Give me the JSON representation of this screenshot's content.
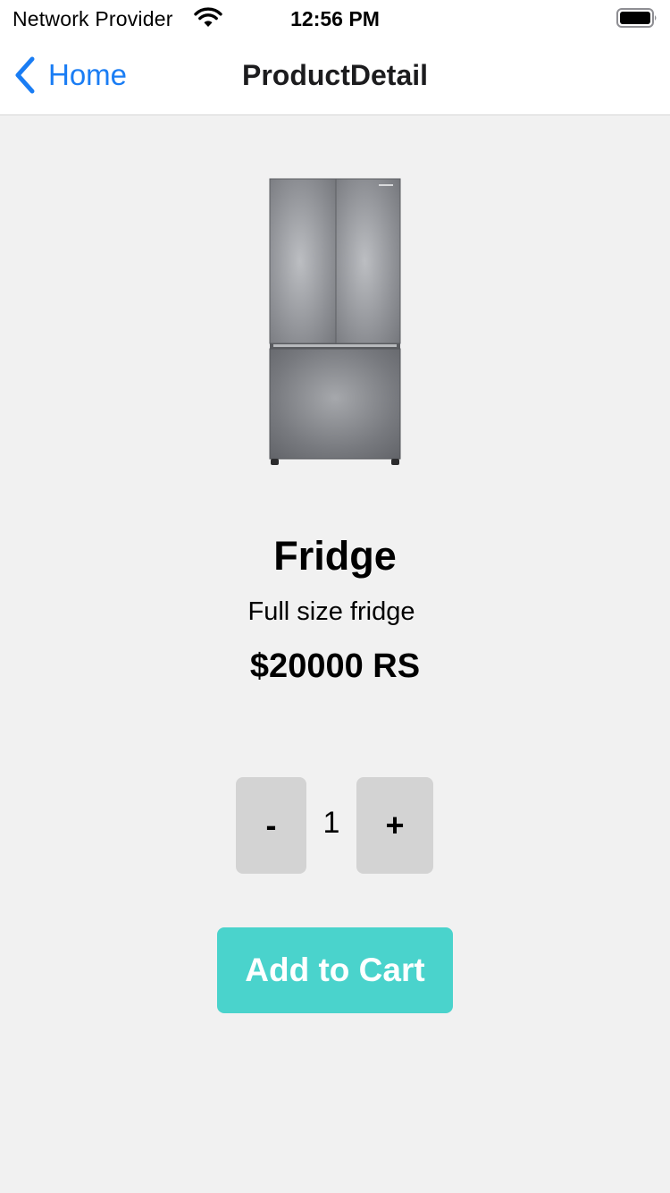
{
  "status_bar": {
    "carrier": "Network Provider",
    "time": "12:56 PM",
    "wifi_icon": "wifi-icon",
    "battery_icon": "battery-icon",
    "battery_level": 1.0
  },
  "nav": {
    "back_label": "Home",
    "back_icon": "chevron-left-icon",
    "title": "ProductDetail",
    "accent_color": "#1a7df4"
  },
  "product": {
    "image_icon": "fridge-image",
    "name": "Fridge",
    "description": "Full size fridge",
    "price": "$20000 RS"
  },
  "quantity": {
    "decrement_label": "-",
    "value": "1",
    "increment_label": "+"
  },
  "cart": {
    "add_label": "Add to Cart",
    "button_color": "#4ad3cc"
  }
}
